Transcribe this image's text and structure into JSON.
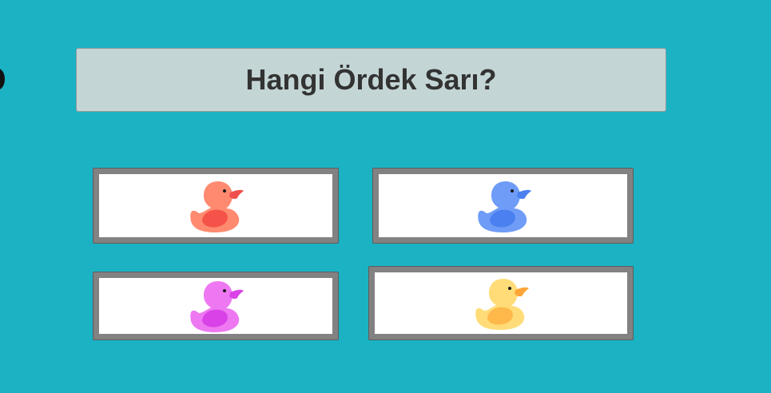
{
  "game": {
    "background_color": "#1bb3c4",
    "question": {
      "text": "Hangi Ördek Sarı?",
      "background_color": "#c4d5d5"
    },
    "card_frame_color": "#828282",
    "options": [
      {
        "id": "red",
        "icon": "duck-icon",
        "color": {
          "body": "#ff8a70",
          "wing": "#f5524a",
          "beak": "#f0504d",
          "eye": "#1a1a1a"
        }
      },
      {
        "id": "blue",
        "icon": "duck-icon",
        "color": {
          "body": "#6e9cf7",
          "wing": "#4a80ef",
          "beak": "#4a80ef",
          "eye": "#1a1a1a"
        }
      },
      {
        "id": "pink",
        "icon": "duck-icon",
        "color": {
          "body": "#ee78f2",
          "wing": "#d842e6",
          "beak": "#d842e6",
          "eye": "#1a1a1a"
        }
      },
      {
        "id": "yellow",
        "icon": "duck-icon",
        "color": {
          "body": "#ffdc78",
          "wing": "#ffb84a",
          "beak": "#ffa537",
          "eye": "#1a1a1a"
        }
      }
    ]
  }
}
